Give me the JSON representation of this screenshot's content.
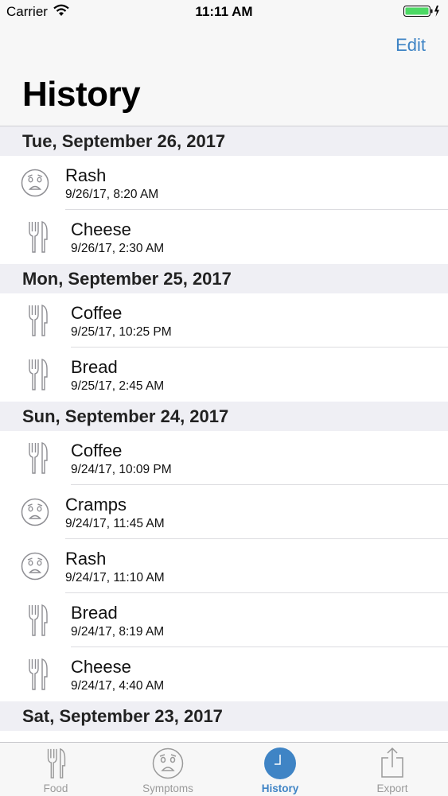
{
  "status_bar": {
    "carrier": "Carrier",
    "time": "11:11 AM",
    "battery_color": "#4cd964"
  },
  "nav": {
    "edit_label": "Edit",
    "title": "History"
  },
  "sections": [
    {
      "header": "Tue, September 26, 2017",
      "items": [
        {
          "type": "symptom",
          "icon": "sad-face-icon",
          "name": "Rash",
          "time": "9/26/17, 8:20 AM"
        },
        {
          "type": "food",
          "icon": "fork-knife-icon",
          "name": "Cheese",
          "time": "9/26/17, 2:30 AM"
        }
      ]
    },
    {
      "header": "Mon, September 25, 2017",
      "items": [
        {
          "type": "food",
          "icon": "fork-knife-icon",
          "name": "Coffee",
          "time": "9/25/17, 10:25 PM"
        },
        {
          "type": "food",
          "icon": "fork-knife-icon",
          "name": "Bread",
          "time": "9/25/17, 2:45 AM"
        }
      ]
    },
    {
      "header": "Sun, September 24, 2017",
      "items": [
        {
          "type": "food",
          "icon": "fork-knife-icon",
          "name": "Coffee",
          "time": "9/24/17, 10:09 PM"
        },
        {
          "type": "symptom",
          "icon": "sad-face-icon",
          "name": "Cramps",
          "time": "9/24/17, 11:45 AM"
        },
        {
          "type": "symptom",
          "icon": "sad-face-icon",
          "name": "Rash",
          "time": "9/24/17, 11:10 AM"
        },
        {
          "type": "food",
          "icon": "fork-knife-icon",
          "name": "Bread",
          "time": "9/24/17, 8:19 AM"
        },
        {
          "type": "food",
          "icon": "fork-knife-icon",
          "name": "Cheese",
          "time": "9/24/17, 4:40 AM"
        }
      ]
    },
    {
      "header": "Sat, September 23, 2017",
      "items": []
    }
  ],
  "tab_bar": {
    "tabs": [
      {
        "label": "Food",
        "icon": "fork-knife-icon",
        "active": false
      },
      {
        "label": "Symptoms",
        "icon": "sad-face-icon",
        "active": false
      },
      {
        "label": "History",
        "icon": "clock-icon",
        "active": true
      },
      {
        "label": "Export",
        "icon": "share-icon",
        "active": false
      }
    ],
    "active_color": "#3f84c5",
    "inactive_color": "#9a9a9a"
  }
}
